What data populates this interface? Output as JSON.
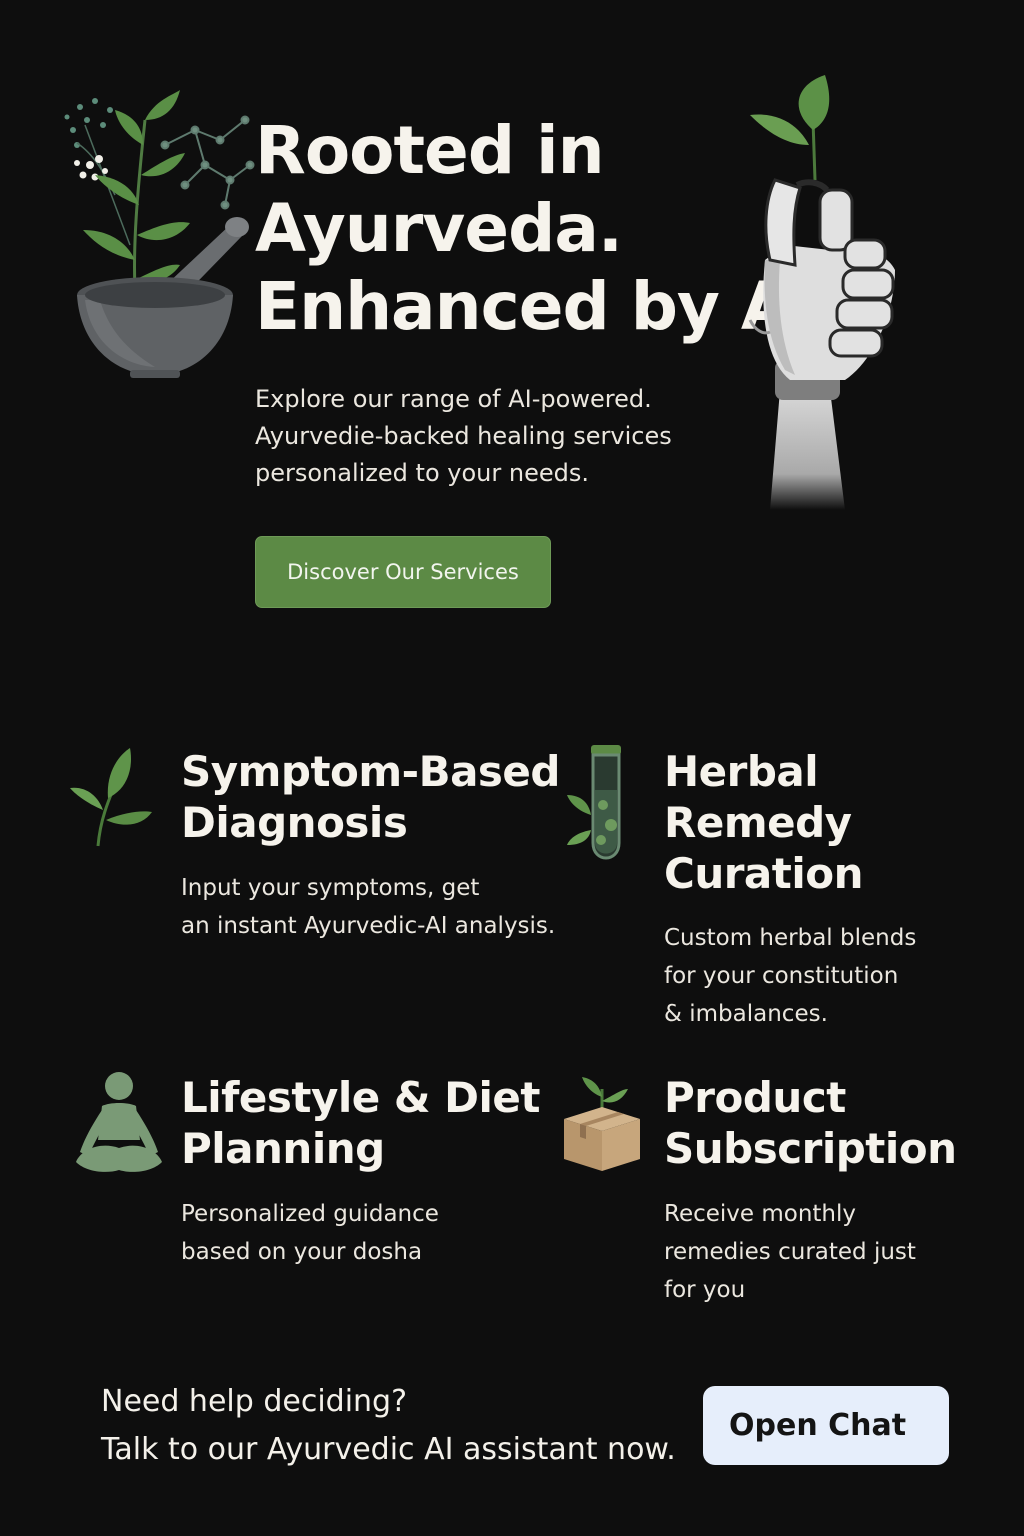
{
  "hero": {
    "title_lines": [
      "Rooted in",
      "Ayurveda.",
      "Enhanced by AI"
    ],
    "subtitle_lines": [
      "Explore our range of AI-powered.",
      "Ayurvedie-backed healing services",
      "personalized to your needs."
    ],
    "cta_label": "Discover Our Services"
  },
  "services": [
    {
      "icon": "leaf-icon",
      "title_lines": [
        "Symptom-Based",
        "Diagnosis"
      ],
      "desc_lines": [
        "Input your symptoms, get",
        "an instant Ayurvedic-AI analysis."
      ]
    },
    {
      "icon": "herb-test-tube-icon",
      "title_lines": [
        "Herbal",
        "Remedy",
        "Curation"
      ],
      "desc_lines": [
        "Custom herbal blends",
        "for your constitution",
        "& imbalances."
      ]
    },
    {
      "icon": "meditation-figure-icon",
      "title_lines": [
        "Lifestyle & Diet",
        "Planning"
      ],
      "desc_lines": [
        "Personalized guidance",
        "based on your dosha"
      ]
    },
    {
      "icon": "sprout-box-icon",
      "title_lines": [
        "Product",
        "Subscription"
      ],
      "desc_lines": [
        "Receive monthly",
        "remedies curated just",
        "for you"
      ]
    }
  ],
  "footer": {
    "help_lines": [
      "Need help deciding?",
      "Talk to our Ayurvedic AI assistant now."
    ],
    "chat_button_label": "Open Chat"
  },
  "colors": {
    "background": "#0e0e0e",
    "accent_green": "#5c8a45",
    "chat_button_bg": "#e6eefb"
  }
}
